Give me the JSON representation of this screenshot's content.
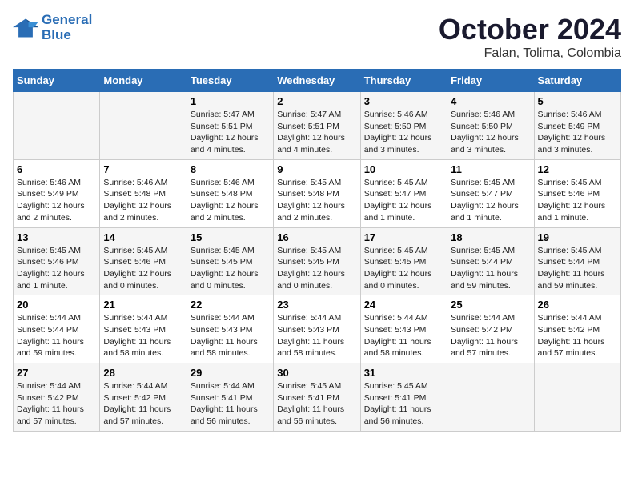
{
  "logo": {
    "line1": "General",
    "line2": "Blue"
  },
  "title": "October 2024",
  "location": "Falan, Tolima, Colombia",
  "weekdays": [
    "Sunday",
    "Monday",
    "Tuesday",
    "Wednesday",
    "Thursday",
    "Friday",
    "Saturday"
  ],
  "weeks": [
    [
      {
        "day": "",
        "sunrise": "",
        "sunset": "",
        "daylight": ""
      },
      {
        "day": "",
        "sunrise": "",
        "sunset": "",
        "daylight": ""
      },
      {
        "day": "1",
        "sunrise": "Sunrise: 5:47 AM",
        "sunset": "Sunset: 5:51 PM",
        "daylight": "Daylight: 12 hours and 4 minutes."
      },
      {
        "day": "2",
        "sunrise": "Sunrise: 5:47 AM",
        "sunset": "Sunset: 5:51 PM",
        "daylight": "Daylight: 12 hours and 4 minutes."
      },
      {
        "day": "3",
        "sunrise": "Sunrise: 5:46 AM",
        "sunset": "Sunset: 5:50 PM",
        "daylight": "Daylight: 12 hours and 3 minutes."
      },
      {
        "day": "4",
        "sunrise": "Sunrise: 5:46 AM",
        "sunset": "Sunset: 5:50 PM",
        "daylight": "Daylight: 12 hours and 3 minutes."
      },
      {
        "day": "5",
        "sunrise": "Sunrise: 5:46 AM",
        "sunset": "Sunset: 5:49 PM",
        "daylight": "Daylight: 12 hours and 3 minutes."
      }
    ],
    [
      {
        "day": "6",
        "sunrise": "Sunrise: 5:46 AM",
        "sunset": "Sunset: 5:49 PM",
        "daylight": "Daylight: 12 hours and 2 minutes."
      },
      {
        "day": "7",
        "sunrise": "Sunrise: 5:46 AM",
        "sunset": "Sunset: 5:48 PM",
        "daylight": "Daylight: 12 hours and 2 minutes."
      },
      {
        "day": "8",
        "sunrise": "Sunrise: 5:46 AM",
        "sunset": "Sunset: 5:48 PM",
        "daylight": "Daylight: 12 hours and 2 minutes."
      },
      {
        "day": "9",
        "sunrise": "Sunrise: 5:45 AM",
        "sunset": "Sunset: 5:48 PM",
        "daylight": "Daylight: 12 hours and 2 minutes."
      },
      {
        "day": "10",
        "sunrise": "Sunrise: 5:45 AM",
        "sunset": "Sunset: 5:47 PM",
        "daylight": "Daylight: 12 hours and 1 minute."
      },
      {
        "day": "11",
        "sunrise": "Sunrise: 5:45 AM",
        "sunset": "Sunset: 5:47 PM",
        "daylight": "Daylight: 12 hours and 1 minute."
      },
      {
        "day": "12",
        "sunrise": "Sunrise: 5:45 AM",
        "sunset": "Sunset: 5:46 PM",
        "daylight": "Daylight: 12 hours and 1 minute."
      }
    ],
    [
      {
        "day": "13",
        "sunrise": "Sunrise: 5:45 AM",
        "sunset": "Sunset: 5:46 PM",
        "daylight": "Daylight: 12 hours and 1 minute."
      },
      {
        "day": "14",
        "sunrise": "Sunrise: 5:45 AM",
        "sunset": "Sunset: 5:46 PM",
        "daylight": "Daylight: 12 hours and 0 minutes."
      },
      {
        "day": "15",
        "sunrise": "Sunrise: 5:45 AM",
        "sunset": "Sunset: 5:45 PM",
        "daylight": "Daylight: 12 hours and 0 minutes."
      },
      {
        "day": "16",
        "sunrise": "Sunrise: 5:45 AM",
        "sunset": "Sunset: 5:45 PM",
        "daylight": "Daylight: 12 hours and 0 minutes."
      },
      {
        "day": "17",
        "sunrise": "Sunrise: 5:45 AM",
        "sunset": "Sunset: 5:45 PM",
        "daylight": "Daylight: 12 hours and 0 minutes."
      },
      {
        "day": "18",
        "sunrise": "Sunrise: 5:45 AM",
        "sunset": "Sunset: 5:44 PM",
        "daylight": "Daylight: 11 hours and 59 minutes."
      },
      {
        "day": "19",
        "sunrise": "Sunrise: 5:45 AM",
        "sunset": "Sunset: 5:44 PM",
        "daylight": "Daylight: 11 hours and 59 minutes."
      }
    ],
    [
      {
        "day": "20",
        "sunrise": "Sunrise: 5:44 AM",
        "sunset": "Sunset: 5:44 PM",
        "daylight": "Daylight: 11 hours and 59 minutes."
      },
      {
        "day": "21",
        "sunrise": "Sunrise: 5:44 AM",
        "sunset": "Sunset: 5:43 PM",
        "daylight": "Daylight: 11 hours and 58 minutes."
      },
      {
        "day": "22",
        "sunrise": "Sunrise: 5:44 AM",
        "sunset": "Sunset: 5:43 PM",
        "daylight": "Daylight: 11 hours and 58 minutes."
      },
      {
        "day": "23",
        "sunrise": "Sunrise: 5:44 AM",
        "sunset": "Sunset: 5:43 PM",
        "daylight": "Daylight: 11 hours and 58 minutes."
      },
      {
        "day": "24",
        "sunrise": "Sunrise: 5:44 AM",
        "sunset": "Sunset: 5:43 PM",
        "daylight": "Daylight: 11 hours and 58 minutes."
      },
      {
        "day": "25",
        "sunrise": "Sunrise: 5:44 AM",
        "sunset": "Sunset: 5:42 PM",
        "daylight": "Daylight: 11 hours and 57 minutes."
      },
      {
        "day": "26",
        "sunrise": "Sunrise: 5:44 AM",
        "sunset": "Sunset: 5:42 PM",
        "daylight": "Daylight: 11 hours and 57 minutes."
      }
    ],
    [
      {
        "day": "27",
        "sunrise": "Sunrise: 5:44 AM",
        "sunset": "Sunset: 5:42 PM",
        "daylight": "Daylight: 11 hours and 57 minutes."
      },
      {
        "day": "28",
        "sunrise": "Sunrise: 5:44 AM",
        "sunset": "Sunset: 5:42 PM",
        "daylight": "Daylight: 11 hours and 57 minutes."
      },
      {
        "day": "29",
        "sunrise": "Sunrise: 5:44 AM",
        "sunset": "Sunset: 5:41 PM",
        "daylight": "Daylight: 11 hours and 56 minutes."
      },
      {
        "day": "30",
        "sunrise": "Sunrise: 5:45 AM",
        "sunset": "Sunset: 5:41 PM",
        "daylight": "Daylight: 11 hours and 56 minutes."
      },
      {
        "day": "31",
        "sunrise": "Sunrise: 5:45 AM",
        "sunset": "Sunset: 5:41 PM",
        "daylight": "Daylight: 11 hours and 56 minutes."
      },
      {
        "day": "",
        "sunrise": "",
        "sunset": "",
        "daylight": ""
      },
      {
        "day": "",
        "sunrise": "",
        "sunset": "",
        "daylight": ""
      }
    ]
  ]
}
